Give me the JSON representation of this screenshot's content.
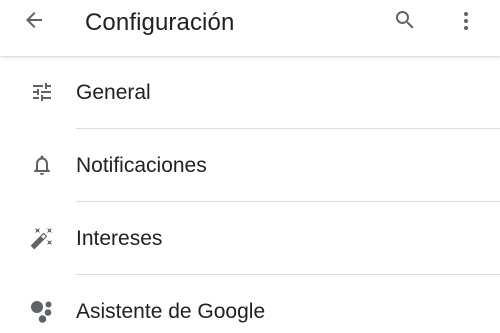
{
  "header": {
    "title": "Configuración",
    "back_icon": "arrow-back-icon",
    "search_icon": "search-icon",
    "more_icon": "more-vert-icon"
  },
  "settings": {
    "items": [
      {
        "label": "General",
        "icon": "tune-icon"
      },
      {
        "label": "Notificaciones",
        "icon": "bell-icon"
      },
      {
        "label": "Intereses",
        "icon": "magic-wand-icon"
      },
      {
        "label": "Asistente de Google",
        "icon": "google-assistant-icon"
      }
    ]
  },
  "colors": {
    "text": "#202124",
    "icon": "#5f6368",
    "divider": "#dadce0",
    "background": "#ffffff"
  }
}
